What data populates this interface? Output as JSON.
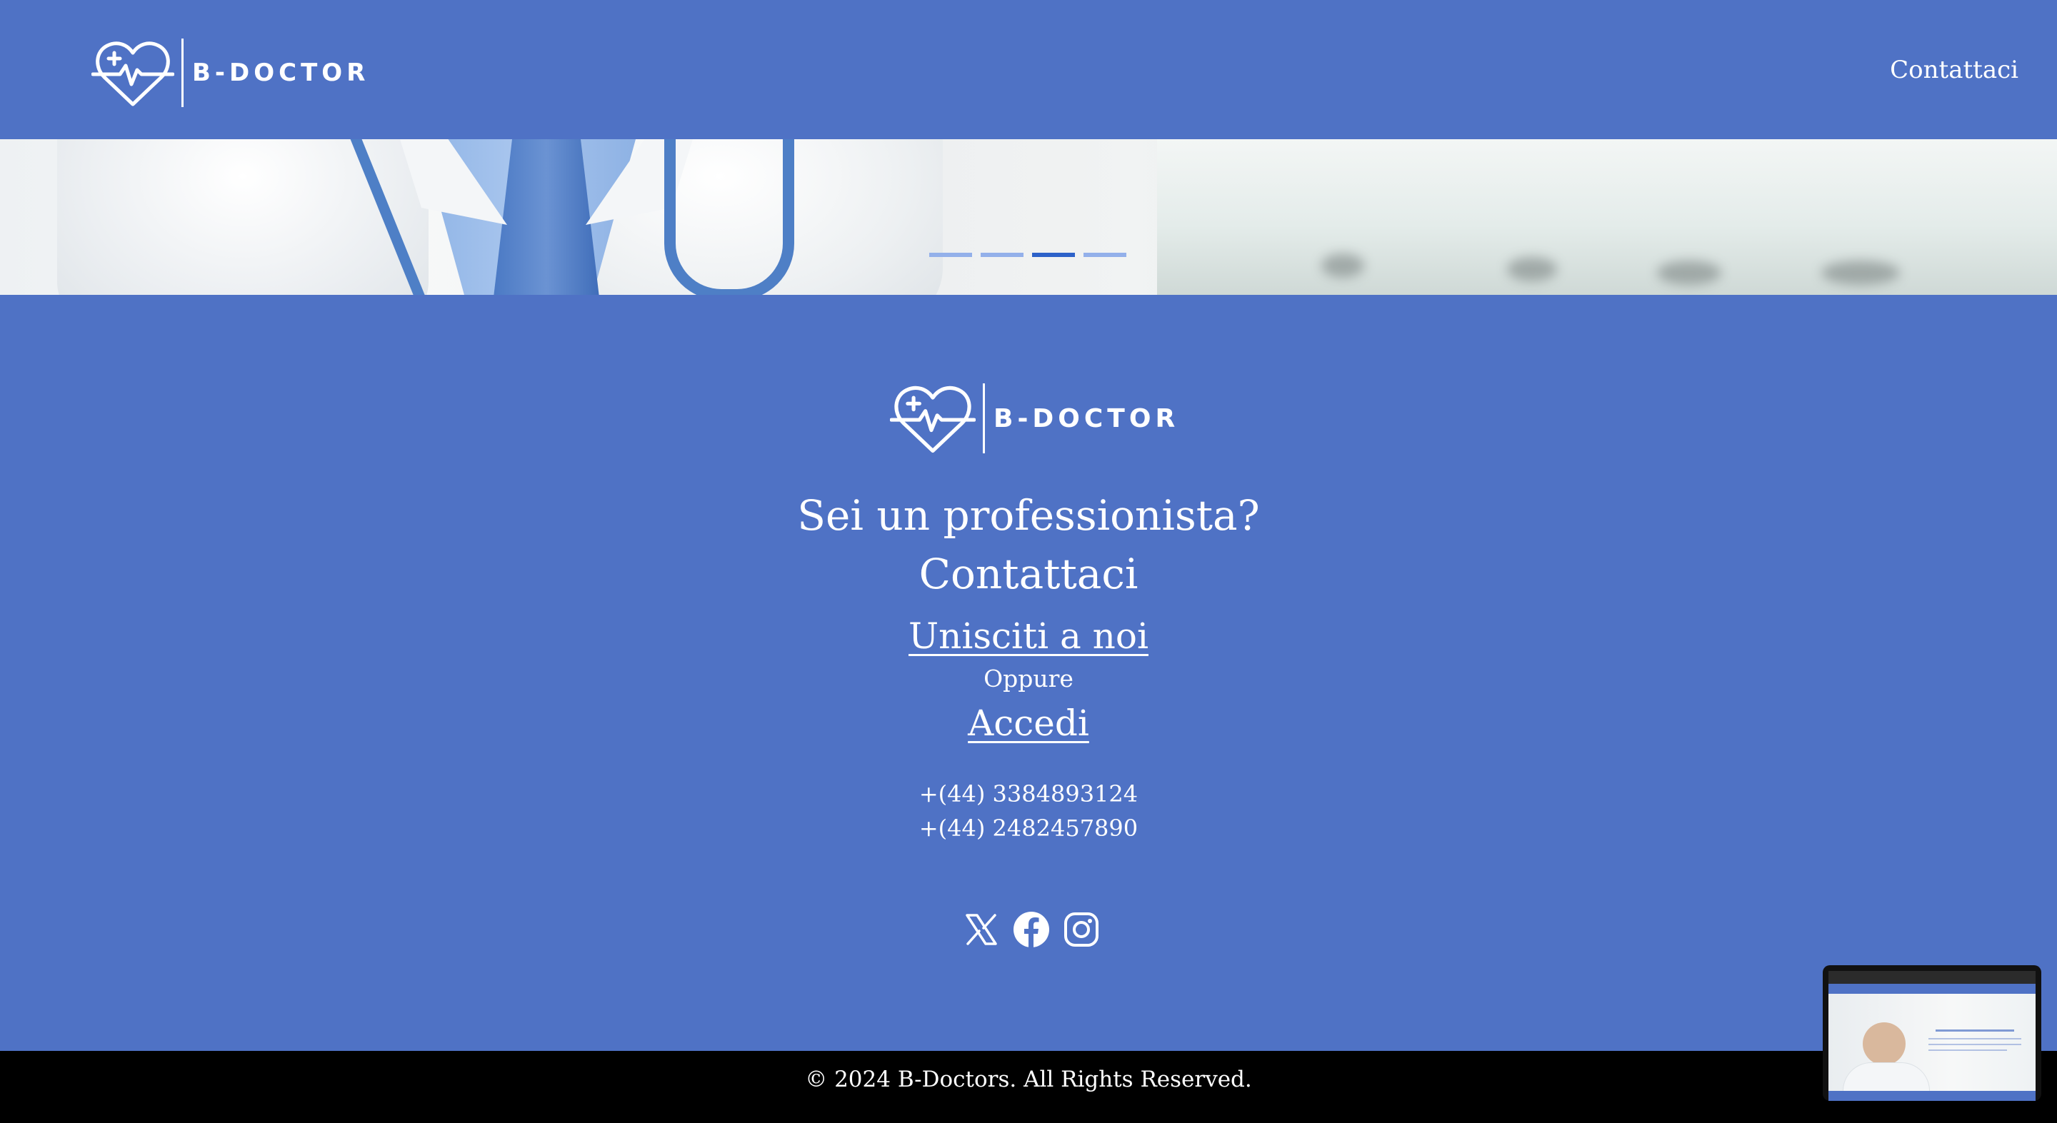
{
  "brand": {
    "name": "B-DOCTOR"
  },
  "nav": {
    "contact_label": "Contattaci"
  },
  "hero": {
    "slides_count": 4,
    "active_slide": 3
  },
  "footer": {
    "heading_line1": "Sei un professionista?",
    "heading_line2": "Contattaci",
    "join_label": "Unisciti a noi",
    "or_label": "Oppure",
    "login_label": "Accedi",
    "phones": [
      "+(44) 3384893124",
      "+(44) 2482457890"
    ],
    "social": [
      "x-icon",
      "facebook-icon",
      "instagram-icon"
    ],
    "copyright": "© 2024 B-Doctors. All Rights Reserved."
  },
  "colors": {
    "primary": "#4f72c5",
    "text": "#ffffff",
    "copyright_bg": "#000000",
    "dot_active": "#2d62c9",
    "dot_inactive": "#93b0ea"
  }
}
